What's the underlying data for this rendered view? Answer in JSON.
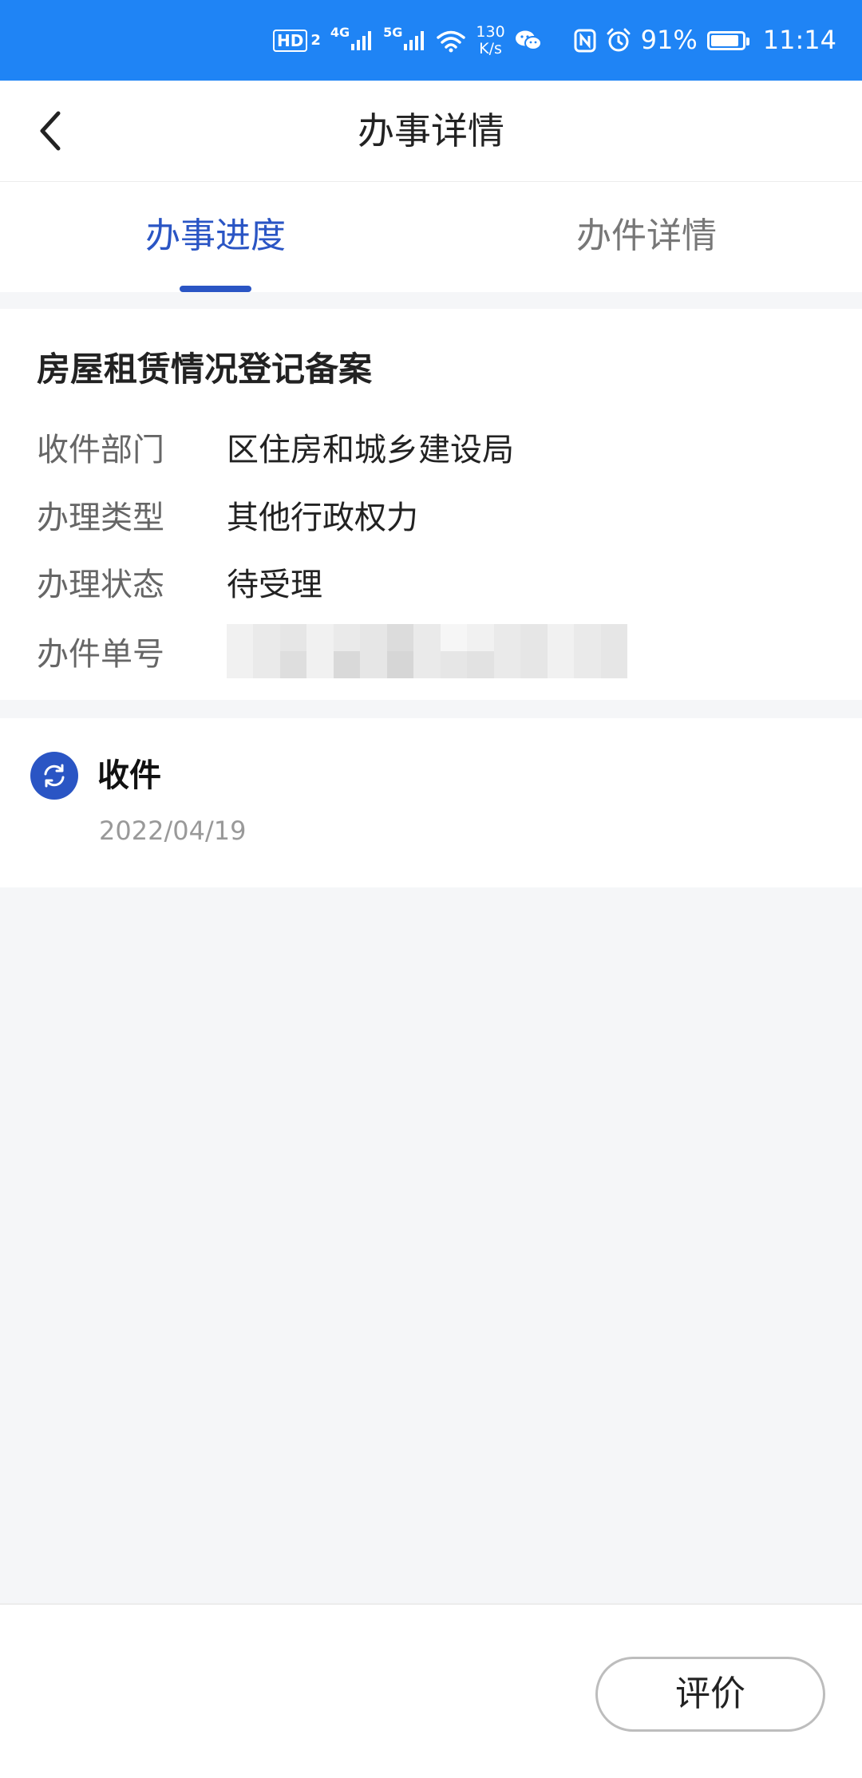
{
  "status_bar": {
    "hd_label": "HD",
    "hd_sub": "2",
    "net1": "4G",
    "net2": "5G",
    "speed_value": "130",
    "speed_unit": "K/s",
    "battery_text": "91%",
    "battery_level": 0.91,
    "time": "11:14",
    "icons": [
      "signal-icon",
      "wifi-icon",
      "wechat-icon",
      "nfc-icon",
      "alarm-icon",
      "battery-icon"
    ]
  },
  "header": {
    "title": "办事详情",
    "back_icon": "chevron-left-icon"
  },
  "tabs": [
    {
      "label": "办事进度",
      "active": true
    },
    {
      "label": "办件详情",
      "active": false
    }
  ],
  "info_card": {
    "title": "房屋租赁情况登记备案",
    "rows": [
      {
        "label": "收件部门",
        "value": "区住房和城乡建设局"
      },
      {
        "label": "办理类型",
        "value": "其他行政权力"
      },
      {
        "label": "办理状态",
        "value": "待受理"
      },
      {
        "label": "办件单号",
        "value": ""
      }
    ]
  },
  "timeline": {
    "steps": [
      {
        "title": "收件",
        "date": "2022/04/19",
        "icon": "refresh-icon"
      }
    ]
  },
  "footer": {
    "rate_label": "评价"
  },
  "colors": {
    "status_bar": "#1f84f5",
    "accent": "#2a55c4",
    "background": "#f5f6f8"
  }
}
